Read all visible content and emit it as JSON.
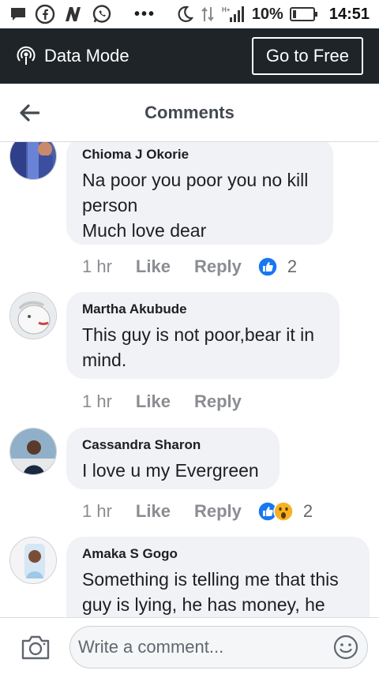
{
  "status_bar": {
    "battery": "10%",
    "time": "14:51",
    "overflow": "•••"
  },
  "data_bar": {
    "mode_label": "Data Mode",
    "go_free_label": "Go to Free"
  },
  "header": {
    "title": "Comments"
  },
  "comments": [
    {
      "author": "Chioma J Okorie",
      "lines": [
        "Na poor you poor you no kill",
        "person",
        "Much love dear"
      ],
      "time": "1 hr",
      "like": "Like",
      "reply": "Reply",
      "reactions": [
        "like"
      ],
      "reaction_count": "2"
    },
    {
      "author": "Martha Akubude",
      "lines": [
        "This guy is not poor,bear it in",
        "mind."
      ],
      "time": "1 hr",
      "like": "Like",
      "reply": "Reply",
      "reactions": [],
      "reaction_count": ""
    },
    {
      "author": "Cassandra Sharon",
      "lines": [
        "I love u my Evergreen"
      ],
      "time": "1 hr",
      "like": "Like",
      "reply": "Reply",
      "reactions": [
        "like",
        "wow"
      ],
      "reaction_count": "2"
    },
    {
      "author": "Amaka S Gogo",
      "lines": [
        "Something is telling me that this",
        "guy is lying, he has money, he"
      ],
      "time": "",
      "like": "",
      "reply": "",
      "reactions": [],
      "reaction_count": ""
    }
  ],
  "composer": {
    "placeholder": "Write a comment..."
  },
  "colors": {
    "data_bar_bg": "#1f2428",
    "bubble_bg": "#f0f2f5",
    "like_blue": "#1877f2",
    "muted_text": "#8a8d91"
  }
}
